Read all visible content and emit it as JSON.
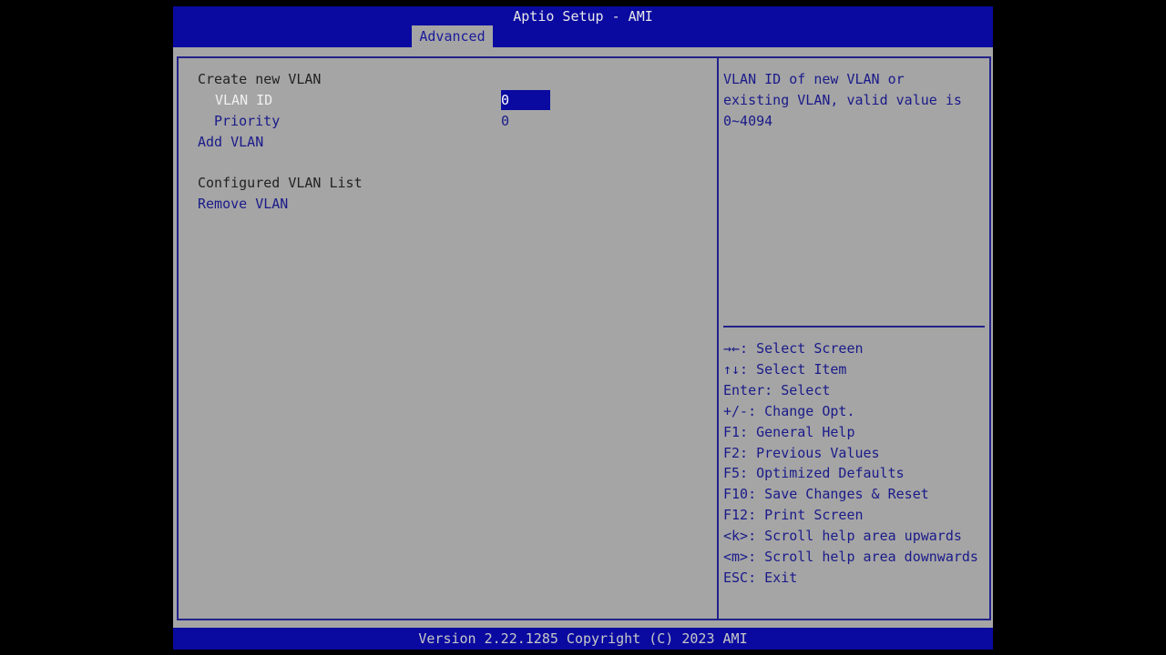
{
  "header": {
    "title": "Aptio Setup - AMI",
    "tab": "Advanced"
  },
  "main": {
    "create_heading": "Create new VLAN",
    "vlan_id_label": "VLAN ID",
    "vlan_id_value": "0",
    "priority_label": "Priority",
    "priority_value": "0",
    "add_vlan": "Add VLAN",
    "configured_heading": "Configured VLAN List",
    "remove_vlan": "Remove VLAN"
  },
  "help": {
    "description": [
      "VLAN ID of new VLAN or",
      "existing VLAN, valid value is",
      "0~4094"
    ],
    "keys": [
      "→←: Select Screen",
      "↑↓: Select Item",
      "Enter: Select",
      "+/-: Change Opt.",
      "F1: General Help",
      "F2: Previous Values",
      "F5: Optimized Defaults",
      "F10: Save Changes & Reset",
      "F12: Print Screen",
      "<k>: Scroll help area upwards",
      "<m>: Scroll help area downwards",
      "ESC: Exit"
    ]
  },
  "footer": {
    "text": "Version 2.22.1285 Copyright (C) 2023 AMI"
  },
  "colors": {
    "header_blue": "#0a0aa0",
    "background_gray": "#a5a5a5"
  }
}
